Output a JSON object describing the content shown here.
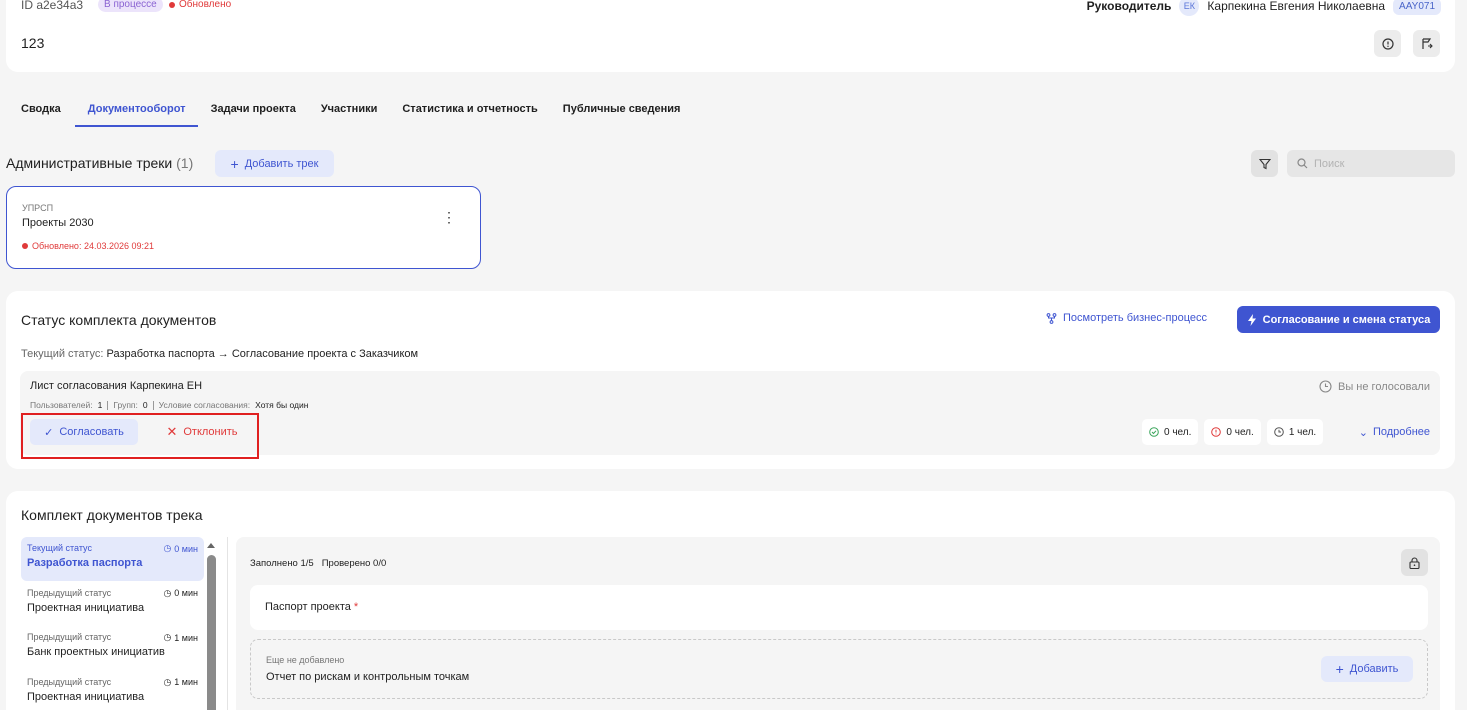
{
  "header": {
    "id_text": "ID a2e34a3",
    "status_badge": "В процессе",
    "updated": "Обновлено",
    "project_name": "123",
    "manager_label": "Руководитель",
    "manager_initials": "ЕК",
    "manager_name": "Карпекина Евгения Николаевна",
    "manager_code": "AAY071"
  },
  "tabs": [
    {
      "label": "Сводка"
    },
    {
      "label": "Документооборот",
      "active": true
    },
    {
      "label": "Задачи проекта"
    },
    {
      "label": "Участники"
    },
    {
      "label": "Статистика и отчетность"
    },
    {
      "label": "Публичные сведения"
    }
  ],
  "admin_tracks": {
    "title": "Административные треки",
    "count": "(1)",
    "add_button": "Добавить трек",
    "search_placeholder": "Поиск"
  },
  "track_card": {
    "code": "УПРСП",
    "name": "Проекты 2030",
    "updated": "Обновлено: 24.03.2026 09:21"
  },
  "status_section": {
    "title": "Статус комплекта документов",
    "bp_link": "Посмотреть бизнес-процесс",
    "primary_button": "Согласование и смена статуса",
    "current_status_label": "Текущий статус:",
    "current_status_value": "Разработка паспорта → Согласование проекта с Заказчиком",
    "approval": {
      "title": "Лист согласования Карпекина ЕН",
      "users_label": "Пользователей:",
      "users": "1",
      "groups_label": "Групп:",
      "groups": "0",
      "condition_label": "Условие согласования:",
      "condition": "Хотя бы один",
      "not_voted": "Вы не голосовали",
      "approve_button": "Согласовать",
      "reject_button": "Отклонить",
      "count_approved": "0 чел.",
      "count_rejected": "0 чел.",
      "count_pending": "1 чел.",
      "more_link": "Подробнее"
    }
  },
  "docs_section": {
    "title": "Комплект документов трека",
    "statuses": [
      {
        "label": "Текущий статус",
        "name": "Разработка паспорта",
        "time": "0 мин",
        "active": true
      },
      {
        "label": "Предыдущий статус",
        "name": "Проектная инициатива",
        "time": "0 мин"
      },
      {
        "label": "Предыдущий статус",
        "name": "Банк проектных инициатив",
        "time": "1 мин"
      },
      {
        "label": "Предыдущий статус",
        "name": "Проектная инициатива",
        "time": "1 мин"
      }
    ],
    "filled": "Заполнено 1/5",
    "checked": "Проверено 0/0",
    "doc1": "Паспорт проекта",
    "doc1_required": "*",
    "doc2_sub": "Еще не добавлено",
    "doc2": "Отчет по рискам и контрольным точкам",
    "add_button": "Добавить"
  },
  "colors": {
    "accent": "#3f55d1",
    "danger": "#e03a3a",
    "badge_purple": "#8a63d2"
  }
}
